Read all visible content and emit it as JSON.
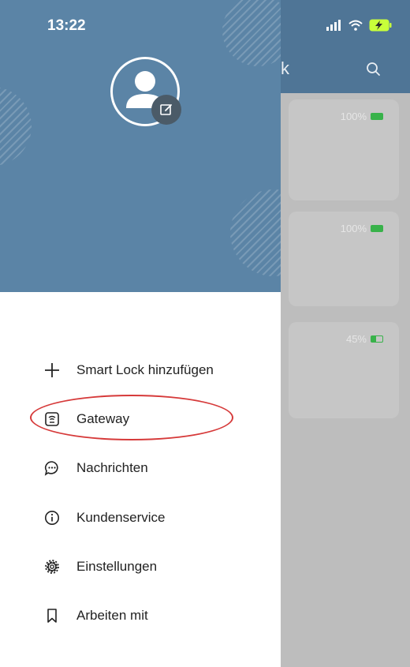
{
  "status_bar": {
    "time": "13:22"
  },
  "background": {
    "title_fragment": "k",
    "cards": [
      {
        "battery_text": "100%",
        "battery_level": 1.0
      },
      {
        "battery_text": "100%",
        "battery_level": 1.0
      },
      {
        "battery_text": "45%",
        "battery_level": 0.45
      }
    ]
  },
  "drawer": {
    "user": {
      "name": "",
      "email": ""
    },
    "menu": [
      {
        "label": "Smart Lock hinzufügen",
        "icon": "plus-icon"
      },
      {
        "label": "Gateway",
        "icon": "gateway-icon"
      },
      {
        "label": "Nachrichten",
        "icon": "chat-bubble-icon"
      },
      {
        "label": "Kundenservice",
        "icon": "info-icon"
      },
      {
        "label": "Einstellungen",
        "icon": "gear-icon"
      },
      {
        "label": "Arbeiten mit",
        "icon": "bookmark-icon"
      }
    ]
  },
  "colors": {
    "drawer_header": "#5b84a6",
    "app_header": "#4f7596",
    "highlight": "#d63a3a",
    "battery": "#38b24a"
  }
}
